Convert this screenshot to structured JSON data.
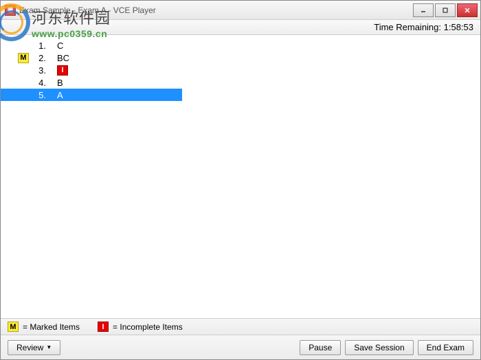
{
  "window": {
    "title": "Exam Sample - Exam A - VCE Player"
  },
  "watermark": {
    "cn": "河东软件园",
    "url": "www.pc0359.cn"
  },
  "timer": {
    "label": "Time Remaining: 1:58:53"
  },
  "questions": [
    {
      "num": "1.",
      "answer": "C",
      "marked": false,
      "incomplete": false,
      "selected": false
    },
    {
      "num": "2.",
      "answer": "BC",
      "marked": true,
      "incomplete": false,
      "selected": false
    },
    {
      "num": "3.",
      "answer": "",
      "marked": false,
      "incomplete": true,
      "selected": false
    },
    {
      "num": "4.",
      "answer": "B",
      "marked": false,
      "incomplete": false,
      "selected": false
    },
    {
      "num": "5.",
      "answer": "A",
      "marked": false,
      "incomplete": false,
      "selected": true
    }
  ],
  "legend": {
    "marked_symbol": "M",
    "marked_text": "= Marked Items",
    "incomplete_symbol": "I",
    "incomplete_text": "= Incomplete Items"
  },
  "buttons": {
    "review": "Review",
    "pause": "Pause",
    "save_session": "Save Session",
    "end_exam": "End Exam"
  }
}
